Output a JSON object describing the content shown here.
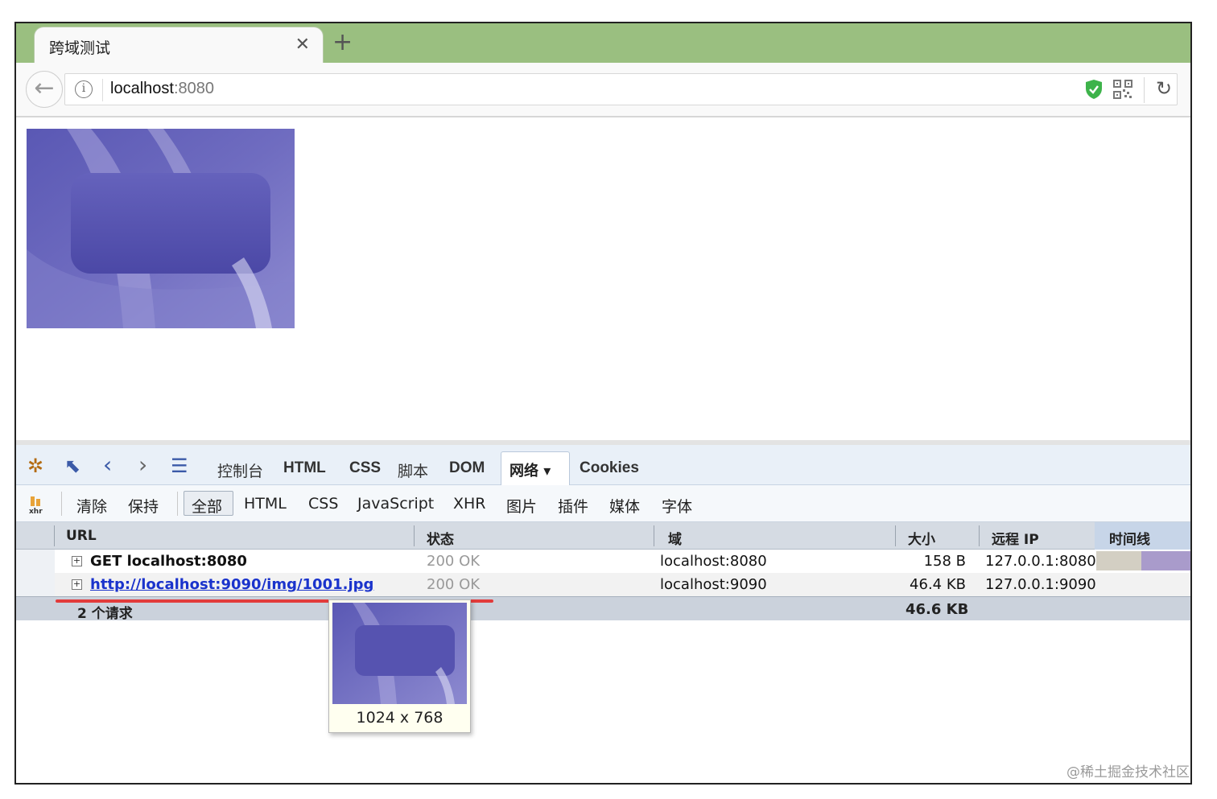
{
  "browser": {
    "tab_title": "跨域测试",
    "tab_close": "✕",
    "new_tab": "+",
    "url_host": "localhost",
    "url_port": ":8080",
    "info_glyph": "i",
    "reload_glyph": "↻",
    "back_glyph": "←",
    "accent_color": "#9abf80"
  },
  "devtools": {
    "tabs": [
      {
        "label": "控制台"
      },
      {
        "label": "HTML"
      },
      {
        "label": "CSS"
      },
      {
        "label": "脚本"
      },
      {
        "label": "DOM"
      },
      {
        "label": "网络 ▾",
        "active": true
      },
      {
        "label": "Cookies"
      }
    ],
    "filters": [
      {
        "label": "清除"
      },
      {
        "label": "保持"
      },
      {
        "label": "全部",
        "active": true
      },
      {
        "label": "HTML"
      },
      {
        "label": "CSS"
      },
      {
        "label": "JavaScript"
      },
      {
        "label": "XHR"
      },
      {
        "label": "图片"
      },
      {
        "label": "插件"
      },
      {
        "label": "媒体"
      },
      {
        "label": "字体"
      }
    ],
    "columns": {
      "url": "URL",
      "status": "状态",
      "domain": "域",
      "size": "大小",
      "remote_ip": "远程 IP",
      "timeline": "时间线"
    },
    "rows": [
      {
        "url": "GET localhost:8080",
        "status": "200 OK",
        "domain": "localhost:8080",
        "size": "158 B",
        "ip": "127.0.0.1:8080"
      },
      {
        "url": "http://localhost:9090/img/1001.jpg",
        "status": "200 OK",
        "domain": "localhost:9090",
        "size": "46.4 KB",
        "ip": "127.0.0.1:9090"
      }
    ],
    "summary": {
      "count": "2 个请求",
      "total_size": "46.6 KB"
    },
    "tooltip": {
      "dimensions": "1024 x 768"
    }
  },
  "watermark": "@稀土掘金技术社区"
}
